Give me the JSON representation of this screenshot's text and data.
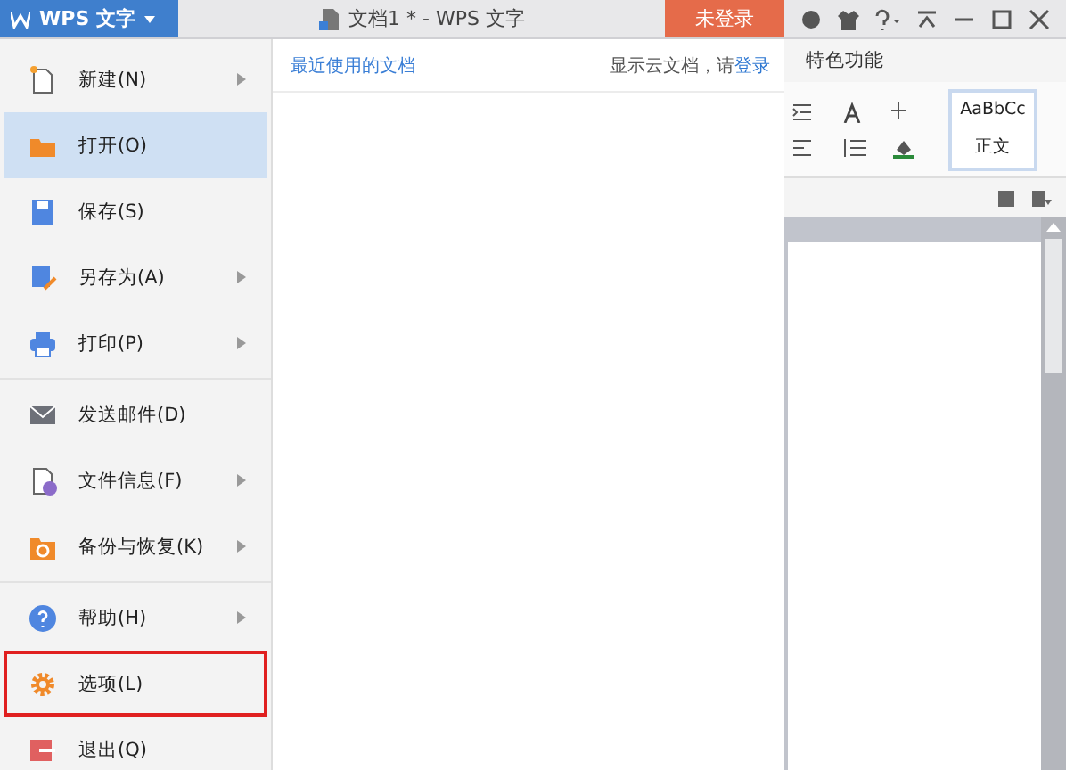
{
  "app_button": {
    "label": "WPS 文字"
  },
  "window": {
    "title": "文档1 * - WPS 文字"
  },
  "login_button": {
    "label": "未登录"
  },
  "menu": {
    "groups": [
      [
        {
          "label": "新建(N)",
          "submenu": true,
          "selected": false,
          "outlined": false
        },
        {
          "label": "打开(O)",
          "submenu": false,
          "selected": true,
          "outlined": false
        },
        {
          "label": "保存(S)",
          "submenu": false,
          "selected": false,
          "outlined": false
        },
        {
          "label": "另存为(A)",
          "submenu": true,
          "selected": false,
          "outlined": false
        },
        {
          "label": "打印(P)",
          "submenu": true,
          "selected": false,
          "outlined": false
        }
      ],
      [
        {
          "label": "发送邮件(D)",
          "submenu": false,
          "selected": false,
          "outlined": false
        },
        {
          "label": "文件信息(F)",
          "submenu": true,
          "selected": false,
          "outlined": false
        },
        {
          "label": "备份与恢复(K)",
          "submenu": true,
          "selected": false,
          "outlined": false
        }
      ],
      [
        {
          "label": "帮助(H)",
          "submenu": true,
          "selected": false,
          "outlined": false
        },
        {
          "label": "选项(L)",
          "submenu": false,
          "selected": false,
          "outlined": true
        },
        {
          "label": "退出(Q)",
          "submenu": false,
          "selected": false,
          "outlined": false
        }
      ]
    ]
  },
  "recent": {
    "title": "最近使用的文档",
    "cloud_note": "显示云文档，请",
    "login_link": "登录"
  },
  "ribbon": {
    "tab": "特色功能",
    "style_sample": "AaBbCc",
    "style_name": "正文"
  }
}
